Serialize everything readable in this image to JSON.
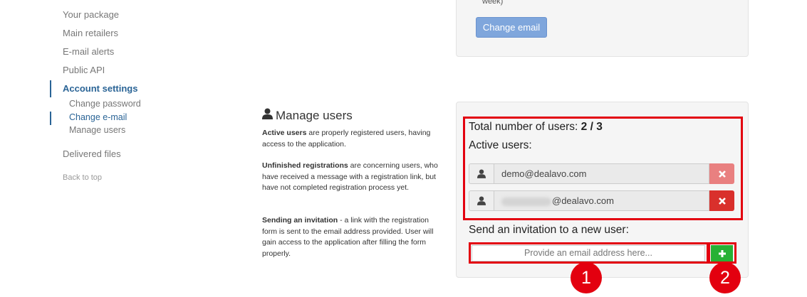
{
  "sidebar": {
    "items": [
      {
        "label": "Your package"
      },
      {
        "label": "Main retailers"
      },
      {
        "label": "E-mail alerts"
      },
      {
        "label": "Public API"
      },
      {
        "label": "Account settings"
      }
    ],
    "subitems": [
      {
        "label": "Change password"
      },
      {
        "label": "Change e-mail"
      },
      {
        "label": "Manage users"
      }
    ],
    "delivered": "Delivered files",
    "back_to_top": "Back to top"
  },
  "change_email_card": {
    "week_text": "week)",
    "button_label": "Change email"
  },
  "manage_users": {
    "heading": "Manage users",
    "paragraphs": [
      {
        "bold": "Active users",
        "text": " are properly registered users, having access to the application."
      },
      {
        "bold": "Unfinished registrations",
        "text": " are concerning users, who have received a message with a registration link, but have not completed registration process yet."
      },
      {
        "bold": "Sending an invitation",
        "text": " - a link with the registration form is sent to the email address provided. User will gain access to the application after filling the form properly."
      }
    ]
  },
  "users_panel": {
    "total_label": "Total number of users:",
    "total_value": "2 / 3",
    "active_label": "Active users:",
    "users": [
      {
        "email": "demo@dealavo.com",
        "remove_icon": "times-icon"
      },
      {
        "email": "@dealavo.com",
        "remove_icon": "times-icon"
      }
    ],
    "invite_label": "Send an invitation to a new user:",
    "invite_placeholder": "Provide an email address here...",
    "add_icon": "plus-icon"
  },
  "markers": [
    "1",
    "2"
  ],
  "colors": {
    "accent": "#2a6496",
    "highlight": "#e3000f",
    "remove_light": "#e98080",
    "remove_dark": "#d9302c",
    "add_green": "#27b135",
    "change_email_btn": "#7fa6dc"
  }
}
